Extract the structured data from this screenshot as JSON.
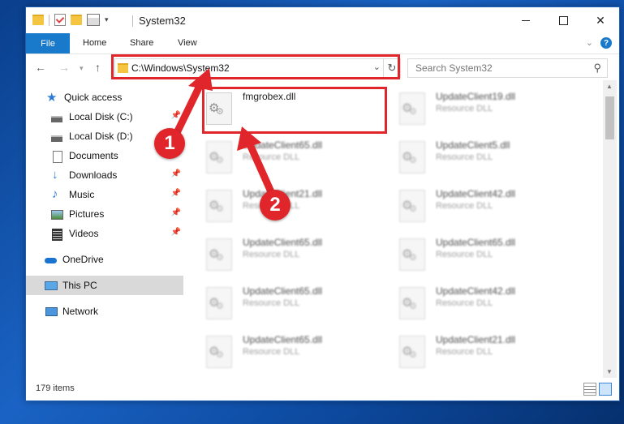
{
  "window": {
    "title": "System32",
    "caption": {
      "minimize": "—",
      "maximize": "",
      "close": "✕"
    }
  },
  "ribbon": {
    "file_tab": "File",
    "tabs": [
      "Home",
      "Share",
      "View"
    ],
    "chevron": "⌄",
    "help": "?"
  },
  "address_bar": {
    "path": "C:\\Windows\\System32",
    "search_placeholder": "Search System32"
  },
  "nav_pane": {
    "items": [
      {
        "label": "Quick access",
        "icon": "star-icon",
        "pinned": false
      },
      {
        "label": "Local Disk (C:)",
        "icon": "drive-icon",
        "pinned": true
      },
      {
        "label": "Local Disk (D:)",
        "icon": "drive-icon",
        "pinned": false
      },
      {
        "label": "Documents",
        "icon": "document-icon",
        "pinned": true
      },
      {
        "label": "Downloads",
        "icon": "download-icon",
        "pinned": true
      },
      {
        "label": "Music",
        "icon": "music-icon",
        "pinned": true
      },
      {
        "label": "Pictures",
        "icon": "picture-icon",
        "pinned": true
      },
      {
        "label": "Videos",
        "icon": "video-icon",
        "pinned": true
      },
      {
        "label": "OneDrive",
        "icon": "cloud-icon",
        "pinned": false
      },
      {
        "label": "This PC",
        "icon": "computer-icon",
        "pinned": false,
        "selected": true
      },
      {
        "label": "Network",
        "icon": "network-icon",
        "pinned": false
      }
    ]
  },
  "files": [
    {
      "name": "fmgrobex.dll",
      "type": "",
      "highlighted": true
    },
    {
      "name": "UpdateClient19.dll",
      "type": "Resource DLL"
    },
    {
      "name": "UpdateClient65.dll",
      "type": "Resource DLL"
    },
    {
      "name": "UpdateClient5.dll",
      "type": "Resource DLL"
    },
    {
      "name": "UpdateClient21.dll",
      "type": "Resource DLL"
    },
    {
      "name": "UpdateClient42.dll",
      "type": "Resource DLL"
    },
    {
      "name": "UpdateClient65.dll",
      "type": "Resource DLL"
    },
    {
      "name": "UpdateClient65.dll",
      "type": "Resource DLL"
    },
    {
      "name": "UpdateClient65.dll",
      "type": "Resource DLL"
    },
    {
      "name": "UpdateClient42.dll",
      "type": "Resource DLL"
    },
    {
      "name": "UpdateClient65.dll",
      "type": "Resource DLL"
    },
    {
      "name": "UpdateClient21.dll",
      "type": "Resource DLL"
    }
  ],
  "status_bar": {
    "item_count": "179 items"
  },
  "annotations": {
    "callout_1": "1",
    "callout_2": "2",
    "color": "#e0262b"
  }
}
